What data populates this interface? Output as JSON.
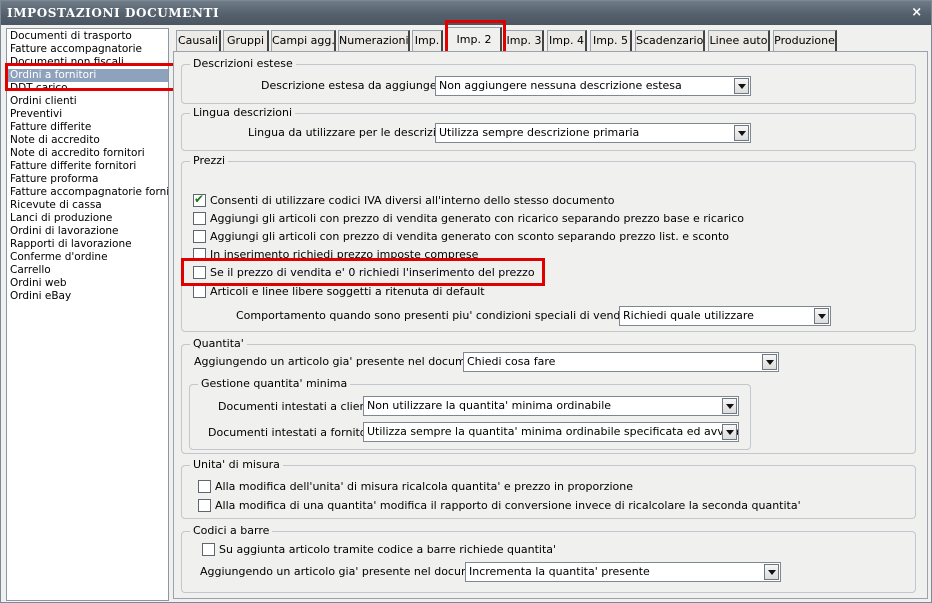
{
  "window": {
    "title": "IMPOSTAZIONI DOCUMENTI",
    "close_label": "×"
  },
  "sidebar": {
    "items": [
      "Documenti di trasporto",
      "Fatture accompagnatorie",
      "Documenti non fiscali",
      "Ordini a fornitori",
      "DDT carico",
      "Ordini clienti",
      "Preventivi",
      "Fatture differite",
      "Note di accredito",
      "Note di accredito fornitori",
      "Fatture differite fornitori",
      "Fatture proforma",
      "Fatture accompagnatorie fornito",
      "Ricevute di cassa",
      "Lanci di produzione",
      "Ordini di lavorazione",
      "Rapporti di lavorazione",
      "Conferme d'ordine",
      "Carrello",
      "Ordini web",
      "Ordini eBay"
    ],
    "selected": "Ordini a fornitori"
  },
  "tabs": [
    "Causali",
    "Gruppi",
    "Campi agg.",
    "Numerazioni",
    "Imp.",
    "Imp. 2",
    "Imp. 3",
    "Imp. 4",
    "Imp. 5",
    "Scadenzario",
    "Linee auto",
    "Produzione"
  ],
  "active_tab": "Imp. 2",
  "descrizioni_estese": {
    "title": "Descrizioni estese",
    "label": "Descrizione estesa da aggiungere :",
    "value": "Non aggiungere nessuna descrizione estesa"
  },
  "lingua_descrizioni": {
    "title": "Lingua descrizioni",
    "label": "Lingua da utilizzare per le descrizioni :",
    "value": "Utilizza sempre descrizione primaria"
  },
  "prezzi": {
    "title": "Prezzi",
    "options": [
      {
        "label": "Consenti di utilizzare codici IVA diversi all'interno dello stesso documento",
        "checked": true
      },
      {
        "label": "Aggiungi gli articoli con prezzo di vendita generato con ricarico separando prezzo base e ricarico",
        "checked": false
      },
      {
        "label": "Aggiungi gli articoli con prezzo di vendita generato con sconto separando prezzo list. e sconto",
        "checked": false
      },
      {
        "label": "In inserimento richiedi prezzo imposte comprese",
        "checked": false
      },
      {
        "label": "Se il prezzo di vendita e' 0 richiedi l'inserimento del prezzo",
        "checked": false
      },
      {
        "label": "Articoli e linee libere soggetti a ritenuta di default",
        "checked": false
      }
    ],
    "special_conditions_label": "Comportamento quando sono presenti piu' condizioni speciali di vendita valide :",
    "special_conditions_value": "Richiedi quale utilizzare"
  },
  "quantita": {
    "title": "Quantita'",
    "existing_label": "Aggiungendo un articolo gia' presente nel documento :",
    "existing_value": "Chiedi cosa fare",
    "min_group_title": "Gestione quantita' minima",
    "clienti_label": "Documenti intestati a clienti :",
    "clienti_value": "Non utilizzare la quantita' minima ordinabile",
    "fornitori_label": "Documenti intestati a fornitori :",
    "fornitori_value": "Utilizza sempre la quantita' minima ordinabile specificata ed avvisa l'utente"
  },
  "unita_misura": {
    "title": "Unita' di misura",
    "options": [
      {
        "label": "Alla modifica dell'unita' di misura ricalcola quantita' e prezzo in proporzione",
        "checked": false
      },
      {
        "label": "Alla modifica di una quantita' modifica il rapporto di conversione invece di ricalcolare la seconda quantita'",
        "checked": false
      }
    ]
  },
  "codici_barre": {
    "title": "Codici a barre",
    "option": {
      "label": "Su aggiunta articolo tramite codice a barre richiede quantita'",
      "checked": false
    },
    "existing_label": "Aggiungendo un articolo gia' presente nel documento :",
    "existing_value": "Incrementa la quantita' presente"
  },
  "colors": {
    "titlebar": "#55616d",
    "selection": "#8fa2bd",
    "highlight": "#e00000"
  }
}
